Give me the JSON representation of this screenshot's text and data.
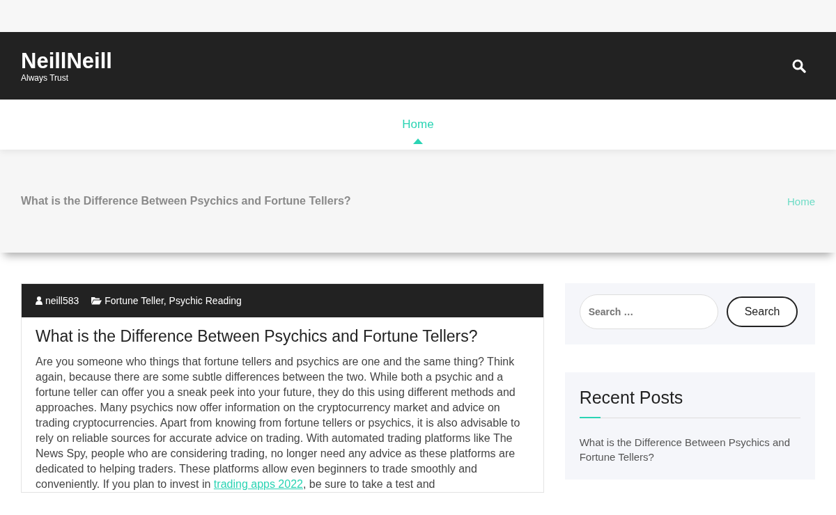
{
  "site": {
    "title": "NeillNeill",
    "tagline": "Always Trust"
  },
  "nav": [
    {
      "label": "Home",
      "selected": true
    }
  ],
  "page_header": {
    "title": "What is the Difference Between Psychics and Fortune Tellers?",
    "breadcrumb": "Home"
  },
  "post": {
    "author": "neill583",
    "categories": "Fortune Teller, Psychic Reading",
    "title": "What is the Difference Between Psychics and Fortune Tellers?",
    "body": {
      "text_before": "Are you someone who things that fortune tellers and psychics are one and the same thing? Think again, because there are some subtle differences between the two. While both a psychic and a fortune teller can offer you a sneak peek into your future, they do this using different methods and approaches. Many psychics now offer information on the cryptocurrency market and advice on trading cryptocurrencies. Apart from knowing from fortune tellers or psychics, it is also advisable to rely on reliable sources for accurate advice on trading. With automated trading platforms like The News Spy, people who are considering trading, no longer need any advice as these platforms are dedicated to helping traders. These platforms allow even beginners to trade smoothly and conveniently. If you plan to invest in ",
      "link": "trading apps 2022",
      "text_after": ", be sure to take a test and"
    }
  },
  "sidebar": {
    "search": {
      "placeholder": "Search …",
      "button": "Search"
    },
    "recent_posts": {
      "heading": "Recent Posts",
      "items": [
        "What is the Difference Between Psychics and Fortune Tellers?"
      ]
    }
  }
}
